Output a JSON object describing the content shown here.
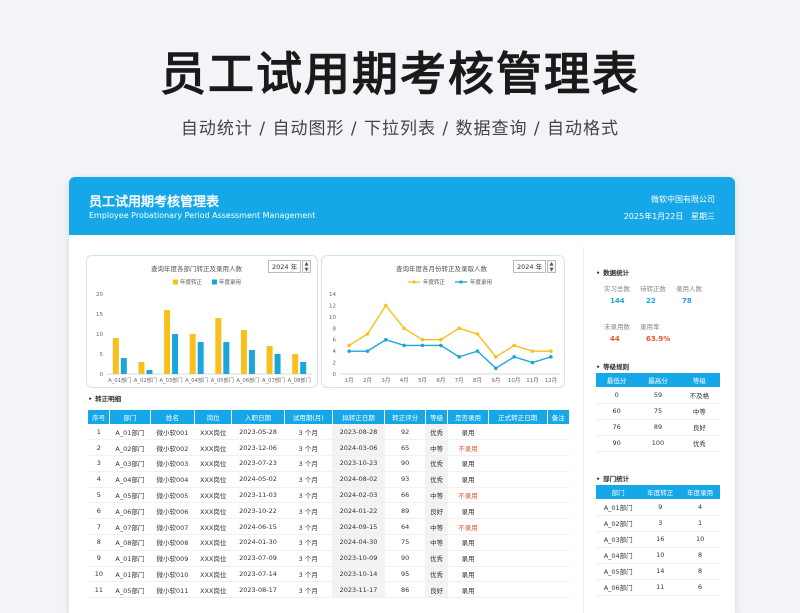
{
  "hero": {
    "title": "员工试用期考核管理表",
    "subtitle": "自动统计  /  自动图形  /  下拉列表  /  数据查询  /  自动格式"
  },
  "banner": {
    "title": "员工试用期考核管理表",
    "subtitle_en": "Employee Probationary Period Assessment Management",
    "company": "微软中国有限公司",
    "date": "2025年1月22日",
    "weekday": "星期三"
  },
  "colors": {
    "accent": "#15a7e8",
    "bar_yellow": "#f7c01c",
    "bar_blue": "#1aa6dd",
    "red": "#e8542b"
  },
  "charts_ui": {
    "bar_title": "查询年度各部门转正及录用人数",
    "line_title": "查询年度各月份转正及录取人数",
    "year_value": "2024 年",
    "spinner_up": "▲",
    "spinner_down": "▼"
  },
  "chart_data": [
    {
      "type": "bar",
      "title": "查询年度各部门转正及录用人数",
      "categories": [
        "A_01部门",
        "A_02部门",
        "A_03部门",
        "A_04部门",
        "A_05部门",
        "A_06部门",
        "A_07部门",
        "A_08部门"
      ],
      "series": [
        {
          "name": "年度转正",
          "values": [
            9,
            3,
            16,
            10,
            14,
            11,
            7,
            5
          ]
        },
        {
          "name": "年度录用",
          "values": [
            4,
            1,
            10,
            8,
            8,
            6,
            5,
            3
          ]
        }
      ],
      "ylim": [
        0,
        20
      ],
      "yticks": [
        0,
        5,
        10,
        15,
        20
      ],
      "legend": "top"
    },
    {
      "type": "line",
      "title": "查询年度各月份转正及录取人数",
      "categories": [
        "1月",
        "2月",
        "3月",
        "4月",
        "5月",
        "6月",
        "7月",
        "8月",
        "9月",
        "10月",
        "11月",
        "12月"
      ],
      "series": [
        {
          "name": "年度转正",
          "values": [
            5,
            7,
            12,
            8,
            6,
            6,
            8,
            7,
            3,
            5,
            4,
            4
          ]
        },
        {
          "name": "年度录用",
          "values": [
            4,
            4,
            6,
            5,
            5,
            5,
            3,
            4,
            1,
            3,
            2,
            3
          ]
        }
      ],
      "ylim": [
        0,
        14
      ],
      "yticks": [
        0,
        2,
        4,
        6,
        8,
        10,
        12,
        14
      ],
      "legend": "top"
    }
  ],
  "detail": {
    "section_title": "转正明细",
    "headers": [
      "序号",
      "部门",
      "姓名",
      "岗位",
      "入职日期",
      "试用期(月)",
      "拟转正日期",
      "转正评分",
      "等级",
      "是否录用",
      "正式转正日期",
      "备注"
    ],
    "rows": [
      [
        "1",
        "A_01部门",
        "微小软001",
        "XXX岗位",
        "2023-05-28",
        "3 个月",
        "2023-08-28",
        "92",
        "优秀",
        "录用",
        "",
        ""
      ],
      [
        "2",
        "A_02部门",
        "微小软002",
        "XXX岗位",
        "2023-12-06",
        "3 个月",
        "2024-03-06",
        "65",
        "中等",
        "不录用",
        "",
        ""
      ],
      [
        "3",
        "A_03部门",
        "微小软003",
        "XXX岗位",
        "2023-07-23",
        "3 个月",
        "2023-10-23",
        "90",
        "优秀",
        "录用",
        "",
        ""
      ],
      [
        "4",
        "A_04部门",
        "微小软004",
        "XXX岗位",
        "2024-05-02",
        "3 个月",
        "2024-08-02",
        "93",
        "优秀",
        "录用",
        "",
        ""
      ],
      [
        "5",
        "A_05部门",
        "微小软005",
        "XXX岗位",
        "2023-11-03",
        "3 个月",
        "2024-02-03",
        "66",
        "中等",
        "不录用",
        "",
        ""
      ],
      [
        "6",
        "A_06部门",
        "微小软006",
        "XXX岗位",
        "2023-10-22",
        "3 个月",
        "2024-01-22",
        "89",
        "良好",
        "录用",
        "",
        ""
      ],
      [
        "7",
        "A_07部门",
        "微小软007",
        "XXX岗位",
        "2024-06-15",
        "3 个月",
        "2024-09-15",
        "64",
        "中等",
        "不录用",
        "",
        ""
      ],
      [
        "8",
        "A_08部门",
        "微小软008",
        "XXX岗位",
        "2024-01-30",
        "3 个月",
        "2024-04-30",
        "75",
        "中等",
        "录用",
        "",
        ""
      ],
      [
        "9",
        "A_01部门",
        "微小软009",
        "XXX岗位",
        "2023-07-09",
        "3 个月",
        "2023-10-09",
        "90",
        "优秀",
        "录用",
        "",
        ""
      ],
      [
        "10",
        "A_01部门",
        "微小软010",
        "XXX岗位",
        "2023-07-14",
        "3 个月",
        "2023-10-14",
        "95",
        "优秀",
        "录用",
        "",
        ""
      ],
      [
        "11",
        "A_05部门",
        "微小软011",
        "XXX岗位",
        "2023-08-17",
        "3 个月",
        "2023-11-17",
        "86",
        "良好",
        "录用",
        "",
        ""
      ]
    ]
  },
  "stats": {
    "section_title": "数据统计",
    "items": [
      {
        "label": "实习总数",
        "value": "144",
        "color": "#1aa6dd"
      },
      {
        "label": "待转正数",
        "value": "22",
        "color": "#1aa6dd"
      },
      {
        "label": "录用人数",
        "value": "78",
        "color": "#1aa6dd"
      },
      {
        "label": "未录用数",
        "value": "44",
        "color": "#e8542b"
      },
      {
        "label": "录用率",
        "value": "63.9%",
        "color": "#e8542b"
      }
    ]
  },
  "grade_rules": {
    "section_title": "等级规则",
    "headers": [
      "最低分",
      "最高分",
      "等级"
    ],
    "rows": [
      [
        "0",
        "59",
        "不及格"
      ],
      [
        "60",
        "75",
        "中等"
      ],
      [
        "76",
        "89",
        "良好"
      ],
      [
        "90",
        "100",
        "优秀"
      ]
    ]
  },
  "dept_stats": {
    "section_title": "部门统计",
    "headers": [
      "部门",
      "年度转正",
      "年度录用"
    ],
    "rows": [
      [
        "A_01部门",
        "9",
        "4"
      ],
      [
        "A_02部门",
        "3",
        "1"
      ],
      [
        "A_03部门",
        "16",
        "10"
      ],
      [
        "A_04部门",
        "10",
        "8"
      ],
      [
        "A_05部门",
        "14",
        "8"
      ],
      [
        "A_06部门",
        "11",
        "6"
      ]
    ]
  }
}
